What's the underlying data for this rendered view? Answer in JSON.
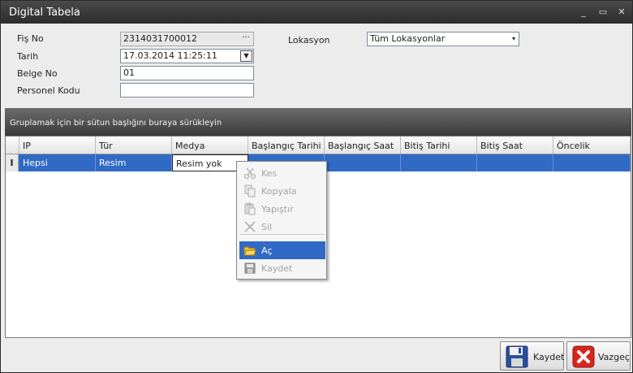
{
  "window": {
    "title": "Digital Tabela"
  },
  "window_controls": {
    "minimize": "_",
    "maximize": "▭",
    "close": "✕"
  },
  "form": {
    "fis_no": {
      "label": "Fiş No",
      "value": "2314031700012",
      "button": "···"
    },
    "tarih": {
      "label": "Tarih",
      "value": "17.03.2014 11:25:11"
    },
    "belge_no": {
      "label": "Belge No",
      "value": "01"
    },
    "personel_kodu": {
      "label": "Personel Kodu",
      "value": ""
    },
    "lokasyon": {
      "label": "Lokasyon",
      "value": "Tüm Lokasyonlar"
    }
  },
  "grid": {
    "group_hint": "Gruplamak için bir sütun başlığını buraya sürükleyin",
    "columns": [
      "IP",
      "Tür",
      "Medya",
      "Başlangıç Tarihi",
      "Başlangıç Saat",
      "Bitiş Tarihi",
      "Bitiş Saat",
      "Öncelik"
    ],
    "row": {
      "indicator": "I",
      "cells": [
        "Hepsi",
        "Resim",
        "Resim yok",
        "",
        "",
        "",
        "",
        ""
      ]
    }
  },
  "context_menu": {
    "items": [
      {
        "label": "Kes",
        "icon": "scissors-icon",
        "enabled": false
      },
      {
        "label": "Kopyala",
        "icon": "copy-icon",
        "enabled": false
      },
      {
        "label": "Yapıştır",
        "icon": "paste-icon",
        "enabled": false
      },
      {
        "label": "Sil",
        "icon": "delete-icon",
        "enabled": false
      },
      {
        "label": "Aç",
        "icon": "folder-open-icon",
        "enabled": true,
        "highlighted": true
      },
      {
        "label": "Kaydet",
        "icon": "save-icon",
        "enabled": false
      }
    ]
  },
  "buttons": {
    "save": "Kaydet",
    "cancel": "Vazgeç"
  },
  "colors": {
    "selection": "#316ac5",
    "titlebar": "#2c2c2c",
    "cancel_red": "#d9261c",
    "save_blue": "#2a4f9a"
  }
}
